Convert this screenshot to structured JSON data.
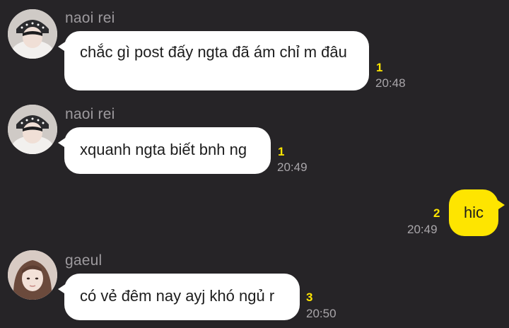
{
  "colors": {
    "background": "#262427",
    "incoming_bubble": "#ffffff",
    "outgoing_bubble": "#fee500",
    "unread_count": "#fee500",
    "sender_name": "#9d9a9e",
    "timestamp": "#a9a6aa"
  },
  "messages": [
    {
      "sender": "naoi rei",
      "text": "chắc gì post đấy ngta đã ám chỉ m đâu",
      "unread": "1",
      "time": "20:48",
      "direction": "incoming"
    },
    {
      "sender": "naoi rei",
      "text": "xquanh ngta biết bnh ng",
      "unread": "1",
      "time": "20:49",
      "direction": "incoming"
    },
    {
      "text": "hic",
      "unread": "2",
      "time": "20:49",
      "direction": "outgoing"
    },
    {
      "sender": "gaeul",
      "text": "có vẻ đêm nay ayj khó ngủ r",
      "unread": "3",
      "time": "20:50",
      "direction": "incoming"
    }
  ]
}
